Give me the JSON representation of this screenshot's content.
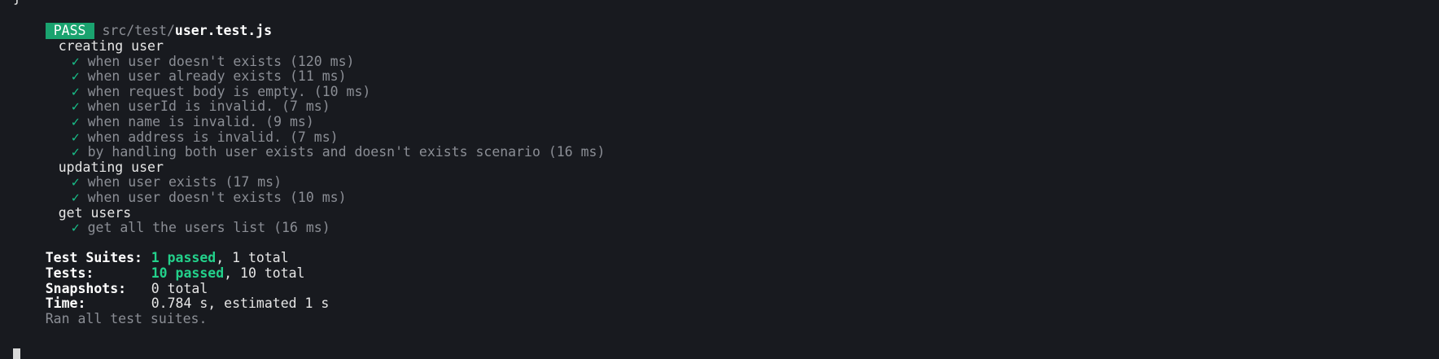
{
  "top_clipped": "}",
  "header": {
    "badge": "PASS",
    "path_prefix": "src/test/",
    "file_name": "user.test.js"
  },
  "check_glyph": "✓",
  "groups": [
    {
      "name": "creating user",
      "tests": [
        "when user doesn't exists (120 ms)",
        "when user already exists (11 ms)",
        "when request body is empty. (10 ms)",
        "when userId is invalid. (7 ms)",
        "when name is invalid. (9 ms)",
        "when address is invalid. (7 ms)",
        "by handling both user exists and doesn't exists scenario (16 ms)"
      ]
    },
    {
      "name": "updating user",
      "tests": [
        "when user exists (17 ms)",
        "when user doesn't exists (10 ms)"
      ]
    },
    {
      "name": "get users",
      "tests": [
        "get all the users list (16 ms)"
      ]
    }
  ],
  "summary": {
    "suites": {
      "label": "Test Suites:",
      "passed": "1 passed",
      "rest": ", 1 total"
    },
    "tests": {
      "label": "Tests:",
      "passed": "10 passed",
      "rest": ", 10 total"
    },
    "snapshots": {
      "label": "Snapshots:",
      "value": "0 total"
    },
    "time": {
      "label": "Time:",
      "value": "0.784 s, estimated 1 s"
    }
  },
  "footer": "Ran all test suites.",
  "colors": {
    "background": "#181a1f",
    "pass_badge": "#1aa36f",
    "passed_text": "#23d18b",
    "check": "#18c08a",
    "dim_text": "#8b8e95"
  }
}
